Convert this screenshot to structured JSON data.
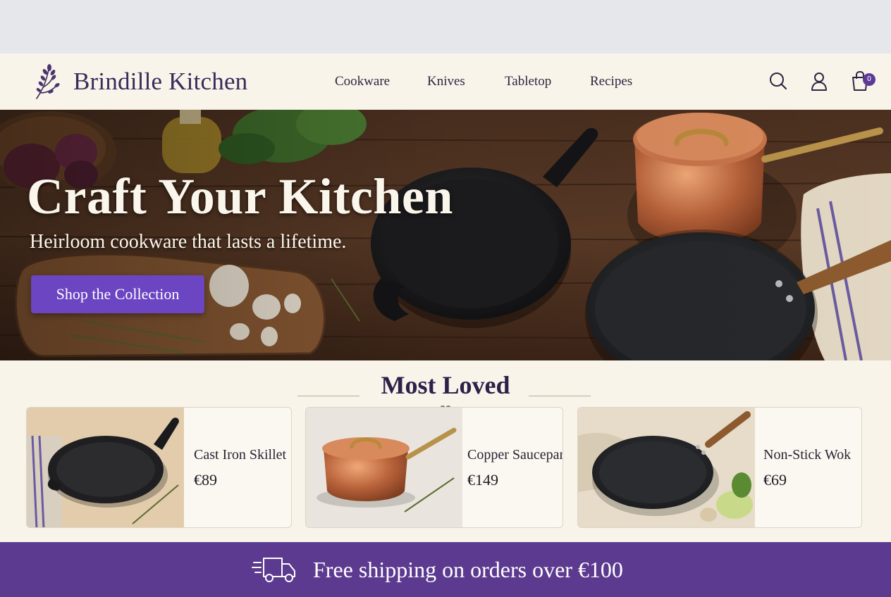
{
  "brand": {
    "name": "Brindille Kitchen",
    "logo_icon": "herb-sprig-icon"
  },
  "nav": {
    "items": [
      "Cookware",
      "Knives",
      "Tabletop",
      "Recipes"
    ]
  },
  "header_icons": {
    "search": "search-icon",
    "account": "user-icon",
    "cart": "shopping-bag-icon",
    "cart_count": "0"
  },
  "hero": {
    "title": "Craft Your Kitchen",
    "subtitle": "Heirloom cookware that lasts a lifetime.",
    "cta_label": "Shop the Collection"
  },
  "featured": {
    "title": "Most Loved",
    "products": [
      {
        "name": "Cast Iron Skillet",
        "price": "€89"
      },
      {
        "name": "Copper Saucepan",
        "price": "€149"
      },
      {
        "name": "Non-Stick Wok",
        "price": "€69"
      }
    ]
  },
  "banner": {
    "text": "Free shipping on orders over €100",
    "icon": "delivery-truck-icon"
  },
  "colors": {
    "accent": "#6b45c2",
    "banner": "#5c3a8f",
    "cream": "#f8f4ea",
    "brand_text": "#3b2a5a"
  }
}
